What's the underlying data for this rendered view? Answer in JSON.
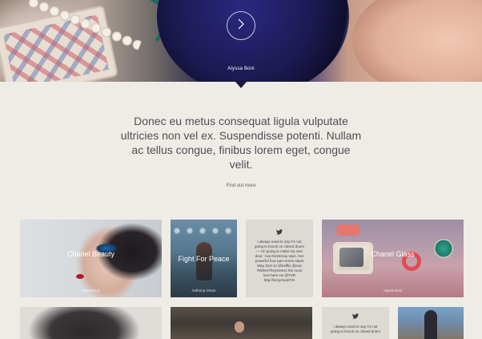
{
  "hero": {
    "caption": "Alyssa Boni",
    "next_icon": "chevron-right-icon"
  },
  "intro": {
    "quote": "Donec eu metus consequat ligula vulputate ultricies non vel ex. Suspendisse potenti. Nullam ac tellus congue, finibus lorem eget, congue velit.",
    "find_out_more": "Find out more"
  },
  "tiles": {
    "beauty": {
      "title": "Chanel Beauty",
      "credit": "Alyssa Boni"
    },
    "fight": {
      "title": "Fight For Peace",
      "credit": "Anthony Orson"
    },
    "tweet1": {
      "icon": "twitter-bird-icon",
      "text": "I always used to say I'm not going to knock on closed doors — I'm going to make my own door.' Ava DuVernay says. Her powerful four-part series starts May 31st on @netflix @ava #WhenTheySeeUs the most loss here via @THR http://bit.ly/4usk7rH"
    },
    "glass": {
      "title": "Chanel Glass",
      "credit": "Alyssa Boni"
    },
    "tweet2": {
      "icon": "twitter-bird-icon",
      "text": "I always used to say I'm not going to knock on closed doors"
    }
  }
}
